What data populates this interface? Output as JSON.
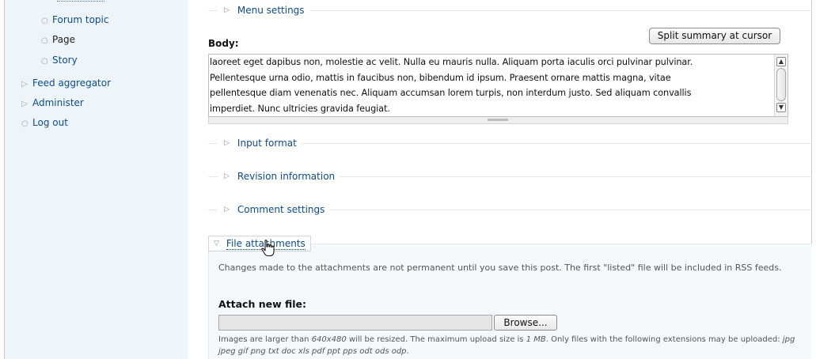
{
  "sidebar": {
    "items": [
      {
        "label": "Forum topic",
        "bullet": "○"
      },
      {
        "label": "Page",
        "bullet": "○"
      },
      {
        "label": "Story",
        "bullet": "○"
      },
      {
        "label": "Feed aggregator",
        "bullet": "▷"
      },
      {
        "label": "Administer",
        "bullet": "▷"
      },
      {
        "label": "Log out",
        "bullet": "○"
      }
    ]
  },
  "fieldsets": {
    "menu_settings": "Menu settings",
    "input_format": "Input format",
    "revision_information": "Revision information",
    "comment_settings": "Comment settings",
    "file_attachments": "File attachments",
    "collapsed_arrow": "▷",
    "expanded_arrow": "▽"
  },
  "body_field": {
    "label": "Body:",
    "split_button": "Split summary at cursor",
    "lines": [
      "laoreet eget dapibus non, molestie ac velit. Nulla eu mauris nulla. Aliquam porta iaculis orci pulvinar pulvinar.",
      "Pellentesque urna odio, mattis in faucibus non, bibendum id ipsum. Praesent ornare mattis magna, vitae",
      "pellentesque diam venenatis nec. Aliquam accumsan lorem turpis, non interdum justo. Sed aliquam convallis",
      "imperdiet. Nunc ultricies gravida feugiat."
    ]
  },
  "attachments": {
    "description": "Changes made to the attachments are not permanent until you save this post. The first \"listed\" file will be included in RSS feeds.",
    "attach_label": "Attach new file:",
    "file_value": "",
    "browse_button": "Browse...",
    "upload_prefix": "Images are larger than ",
    "upload_dims": "640x480",
    "upload_mid": " will be resized. The maximum upload size is ",
    "upload_size": "1 MB",
    "upload_suffix": ". Only files with the following extensions may be uploaded: ",
    "upload_exts": "jpg jpeg gif png txt doc xls pdf ppt pps odt ods odp",
    "upload_end": "."
  },
  "colors": {
    "link": "#0b4c8c",
    "sidebar_bg": "#edf5fa",
    "panel_bg": "#f4f9fc"
  },
  "icons": {
    "cursor": "hand-pointer-icon"
  }
}
